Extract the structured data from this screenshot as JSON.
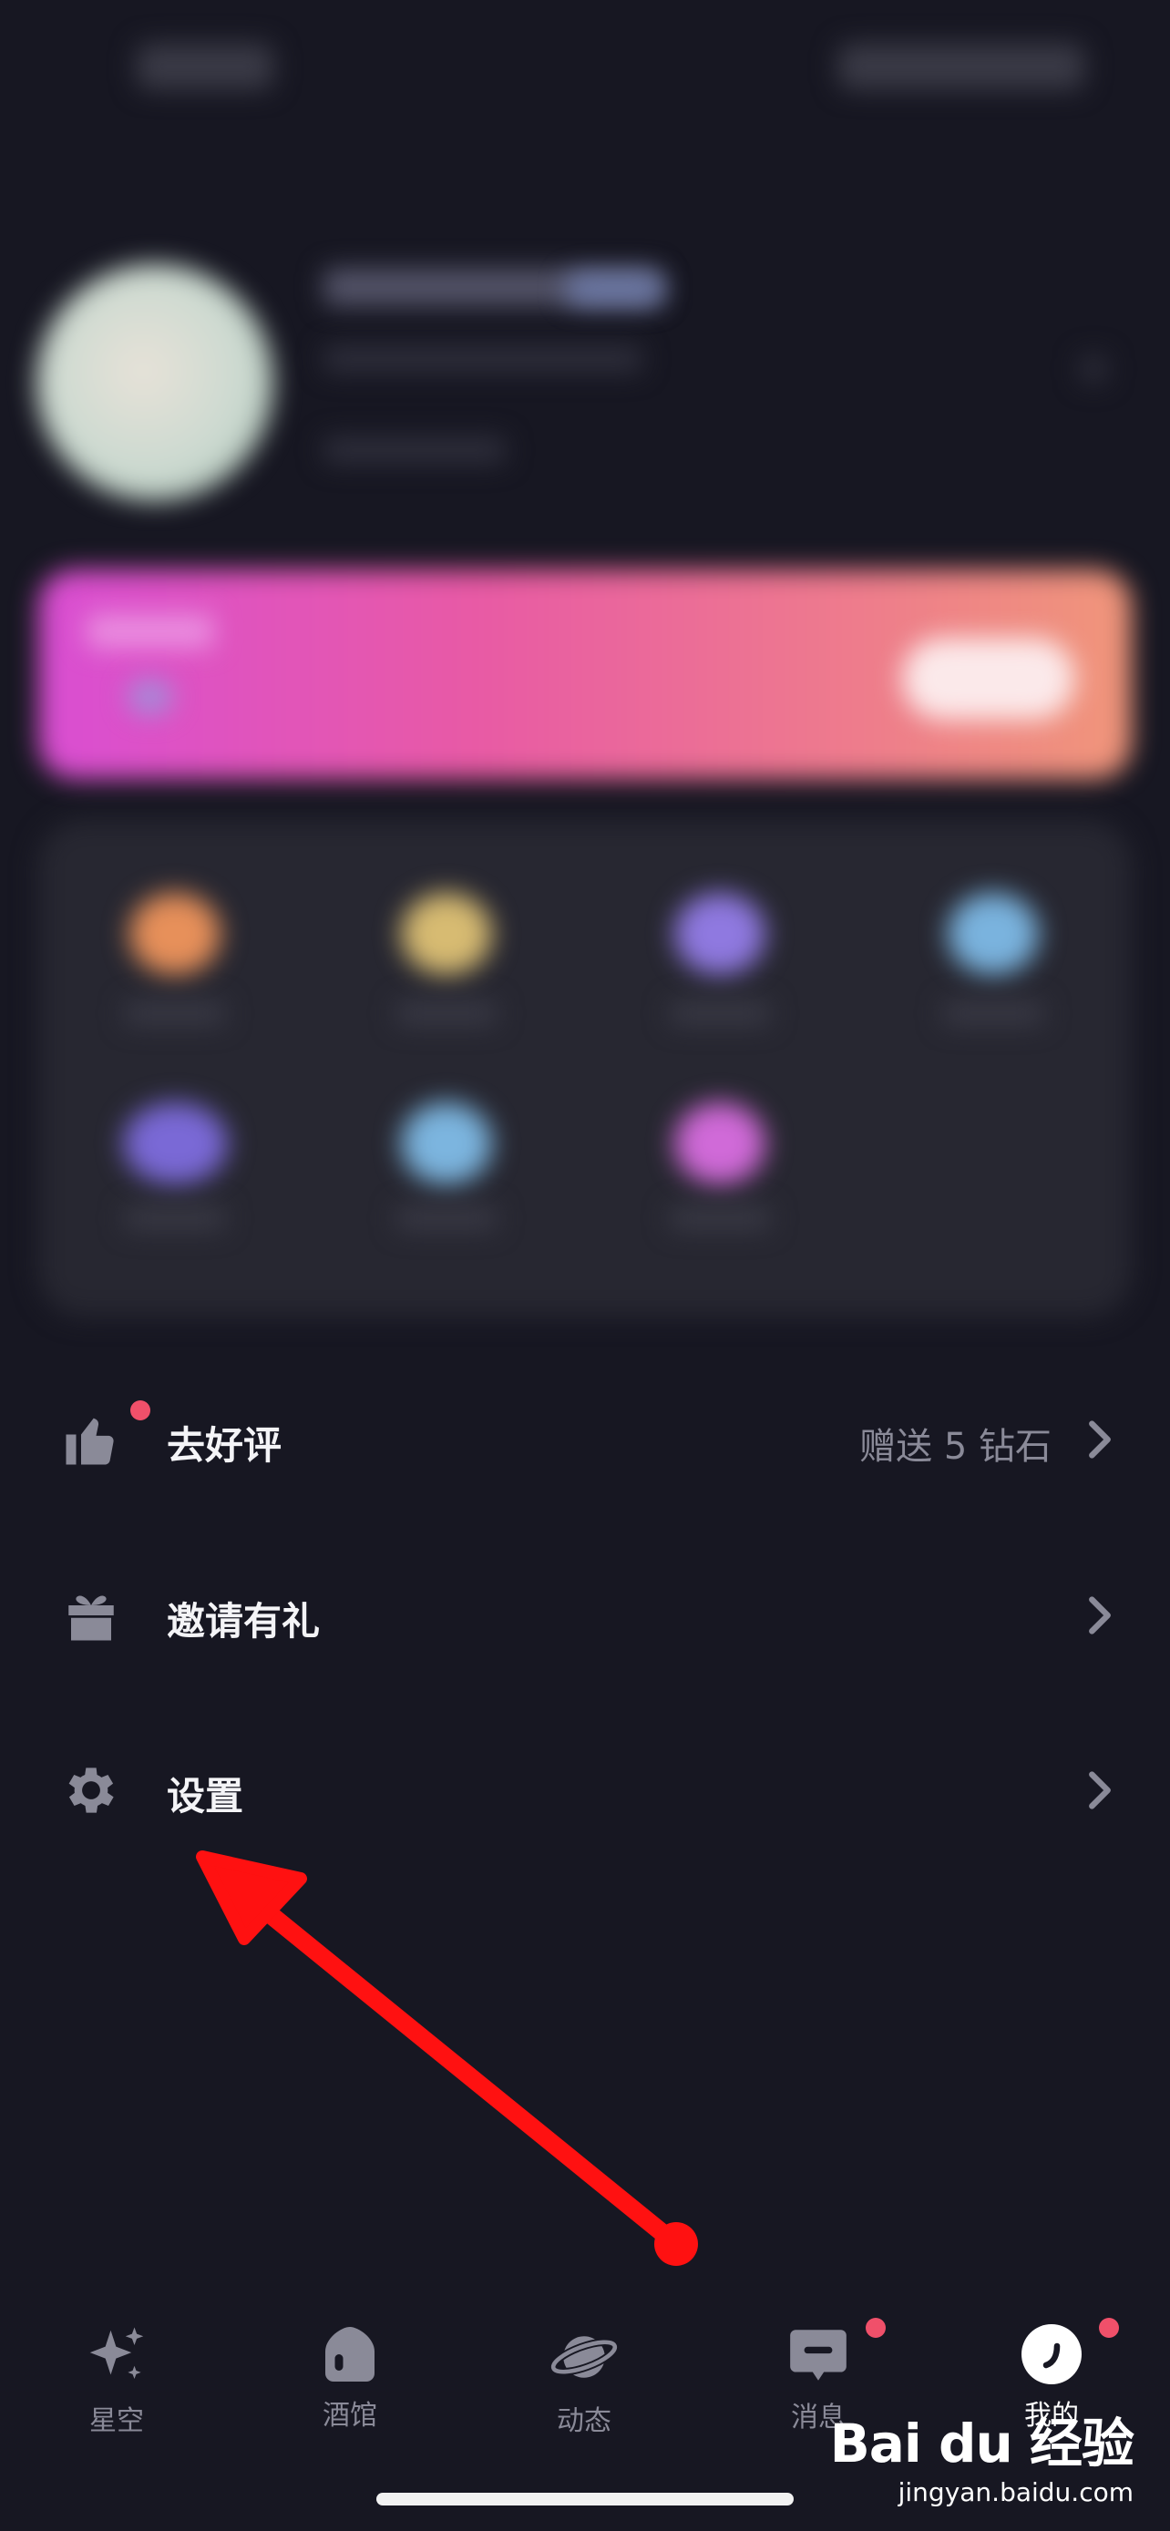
{
  "menu": {
    "items": [
      {
        "label": "去好评",
        "right_text": "赠送 5 钻石",
        "icon": "thumbs-up-icon",
        "badge": true
      },
      {
        "label": "邀请有礼",
        "right_text": "",
        "icon": "gift-icon",
        "badge": false
      },
      {
        "label": "设置",
        "right_text": "",
        "icon": "gear-icon",
        "badge": false
      }
    ]
  },
  "tabbar": {
    "tabs": [
      {
        "label": "星空",
        "icon": "sparkle-icon",
        "active": false,
        "badge": false
      },
      {
        "label": "酒馆",
        "icon": "tavern-icon",
        "active": false,
        "badge": false
      },
      {
        "label": "动态",
        "icon": "planet-icon",
        "active": false,
        "badge": false
      },
      {
        "label": "消息",
        "icon": "message-icon",
        "active": false,
        "badge": true
      },
      {
        "label": "我的",
        "icon": "profile-icon",
        "active": true,
        "badge": true
      }
    ]
  },
  "annotation": {
    "arrow_color": "#ff1111"
  },
  "watermark": {
    "logo": "Bai du 经验",
    "url": "jingyan.baidu.com"
  },
  "colors": {
    "background": "#171722",
    "badge": "#f0506a",
    "muted_text": "#8a8a98"
  }
}
